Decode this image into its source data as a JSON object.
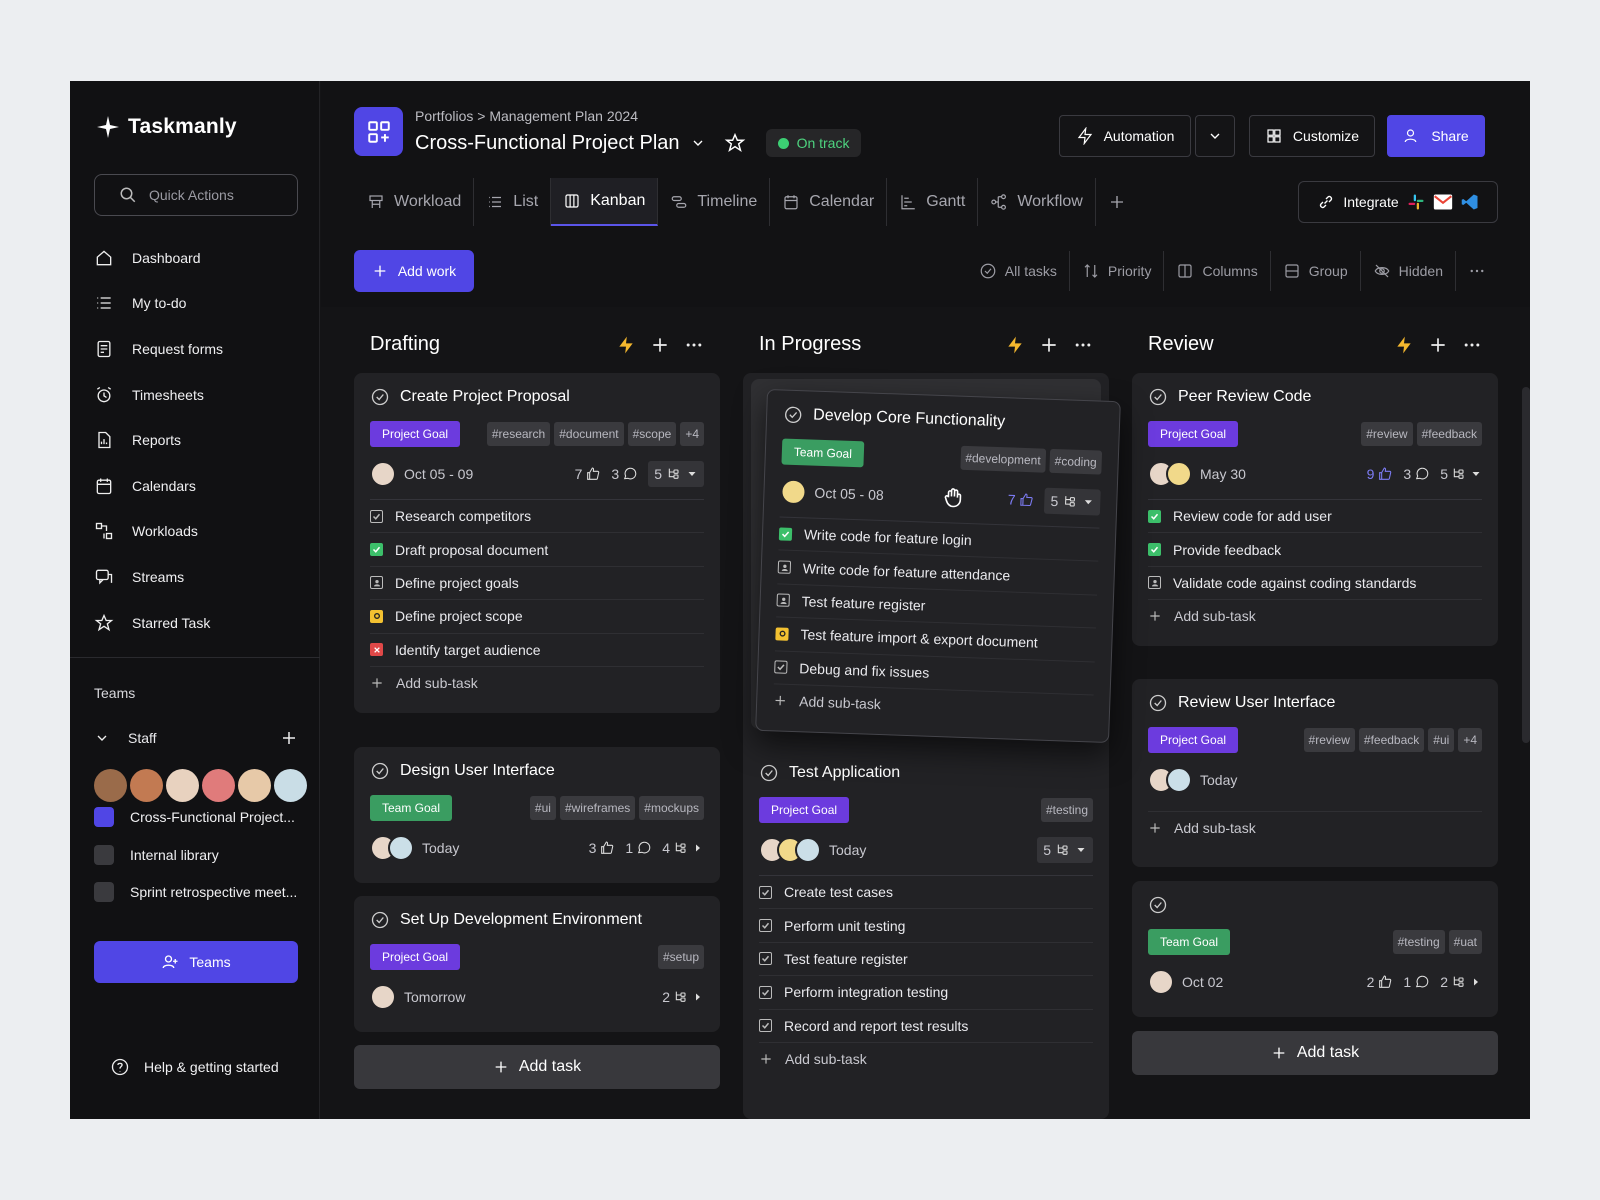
{
  "app": {
    "name": "Taskmanly",
    "quick_actions": "Quick Actions"
  },
  "nav": [
    {
      "label": "Dashboard"
    },
    {
      "label": "My to-do"
    },
    {
      "label": "Request forms"
    },
    {
      "label": "Timesheets"
    },
    {
      "label": "Reports"
    },
    {
      "label": "Calendars"
    },
    {
      "label": "Workloads"
    },
    {
      "label": "Streams"
    },
    {
      "label": "Starred Task"
    }
  ],
  "teams": {
    "heading": "Teams",
    "group": "Staff",
    "projects": [
      {
        "label": "Cross-Functional Project...",
        "color": "#5046e5"
      },
      {
        "label": "Internal library",
        "color": "#3a3a3e"
      },
      {
        "label": "Sprint retrospective meet...",
        "color": "#3a3a3e"
      }
    ],
    "button": "Teams"
  },
  "help": "Help & getting started",
  "header": {
    "breadcrumb": "Portfolios > Management Plan 2024",
    "title": "Cross-Functional Project Plan",
    "status": "On track",
    "automation": "Automation",
    "customize": "Customize",
    "share": "Share",
    "integrate": "Integrate"
  },
  "tabs": [
    "Workload",
    "List",
    "Kanban",
    "Timeline",
    "Calendar",
    "Gantt",
    "Workflow"
  ],
  "toolbar": {
    "add_work": "Add work",
    "all_tasks": "All tasks",
    "priority": "Priority",
    "columns": "Columns",
    "group": "Group",
    "hidden": "Hidden"
  },
  "columns": [
    {
      "title": "Drafting",
      "add_task": "Add task",
      "cards": [
        {
          "title": "Create Project Proposal",
          "goal": "Project Goal",
          "tags": [
            "#research",
            "#document",
            "#scope",
            "+4"
          ],
          "date": "Oct 05 - 09",
          "likes": "7",
          "comments": "3",
          "subs": "5",
          "subtasks": [
            "Research competitors",
            "Draft proposal document",
            "Define project goals",
            "Define project scope",
            "Identify target audience"
          ],
          "add_sub": "Add sub-task"
        },
        {
          "title": "Design User Interface",
          "goal": "Team Goal",
          "tags": [
            "#ui",
            "#wireframes",
            "#mockups"
          ],
          "date": "Today",
          "likes": "3",
          "comments": "1",
          "subs": "4"
        },
        {
          "title": "Set Up Development Environment",
          "goal": "Project Goal",
          "tags": [
            "#setup"
          ],
          "date": "Tomorrow",
          "subs": "2"
        }
      ]
    },
    {
      "title": "In Progress",
      "cards": [
        {
          "title": "Develop Core Functionality",
          "goal": "Team Goal",
          "tags": [
            "#development",
            "#coding"
          ],
          "date": "Oct 05 - 08",
          "likes": "7",
          "subs": "5",
          "subtasks": [
            "Write code for feature login",
            "Write code for feature attendance",
            "Test feature register",
            "Test feature import & export document",
            "Debug and fix issues"
          ],
          "add_sub": "Add sub-task"
        },
        {
          "title": "Test Application",
          "goal": "Project Goal",
          "tags": [
            "#testing"
          ],
          "date": "Today",
          "subs": "5",
          "subtasks": [
            "Create test cases",
            "Perform unit testing",
            "Test feature register",
            "Perform integration testing",
            "Record and report test results"
          ],
          "add_sub": "Add sub-task"
        }
      ]
    },
    {
      "title": "Review",
      "add_task": "Add task",
      "cards": [
        {
          "title": "Peer Review Code",
          "goal": "Project Goal",
          "tags": [
            "#review",
            "#feedback"
          ],
          "date": "May 30",
          "likes": "9",
          "comments": "3",
          "subs": "5",
          "subtasks": [
            "Review code for add user",
            "Provide feedback",
            "Validate code against coding standards"
          ],
          "add_sub": "Add sub-task"
        },
        {
          "title": "Review User Interface",
          "goal": "Project Goal",
          "tags": [
            "#review",
            "#feedback",
            "#ui",
            "+4"
          ],
          "date": "Today",
          "add_sub": "Add sub-task"
        },
        {
          "goal": "Team Goal",
          "tags": [
            "#testing",
            "#uat"
          ],
          "date": "Oct 02",
          "likes": "2",
          "comments": "1",
          "subs": "2"
        }
      ]
    }
  ],
  "colors": {
    "accent": "#5046e5",
    "on_track": "#3ccf73",
    "team_goal": "#3a9d61",
    "project_goal": "#6c3bde"
  }
}
